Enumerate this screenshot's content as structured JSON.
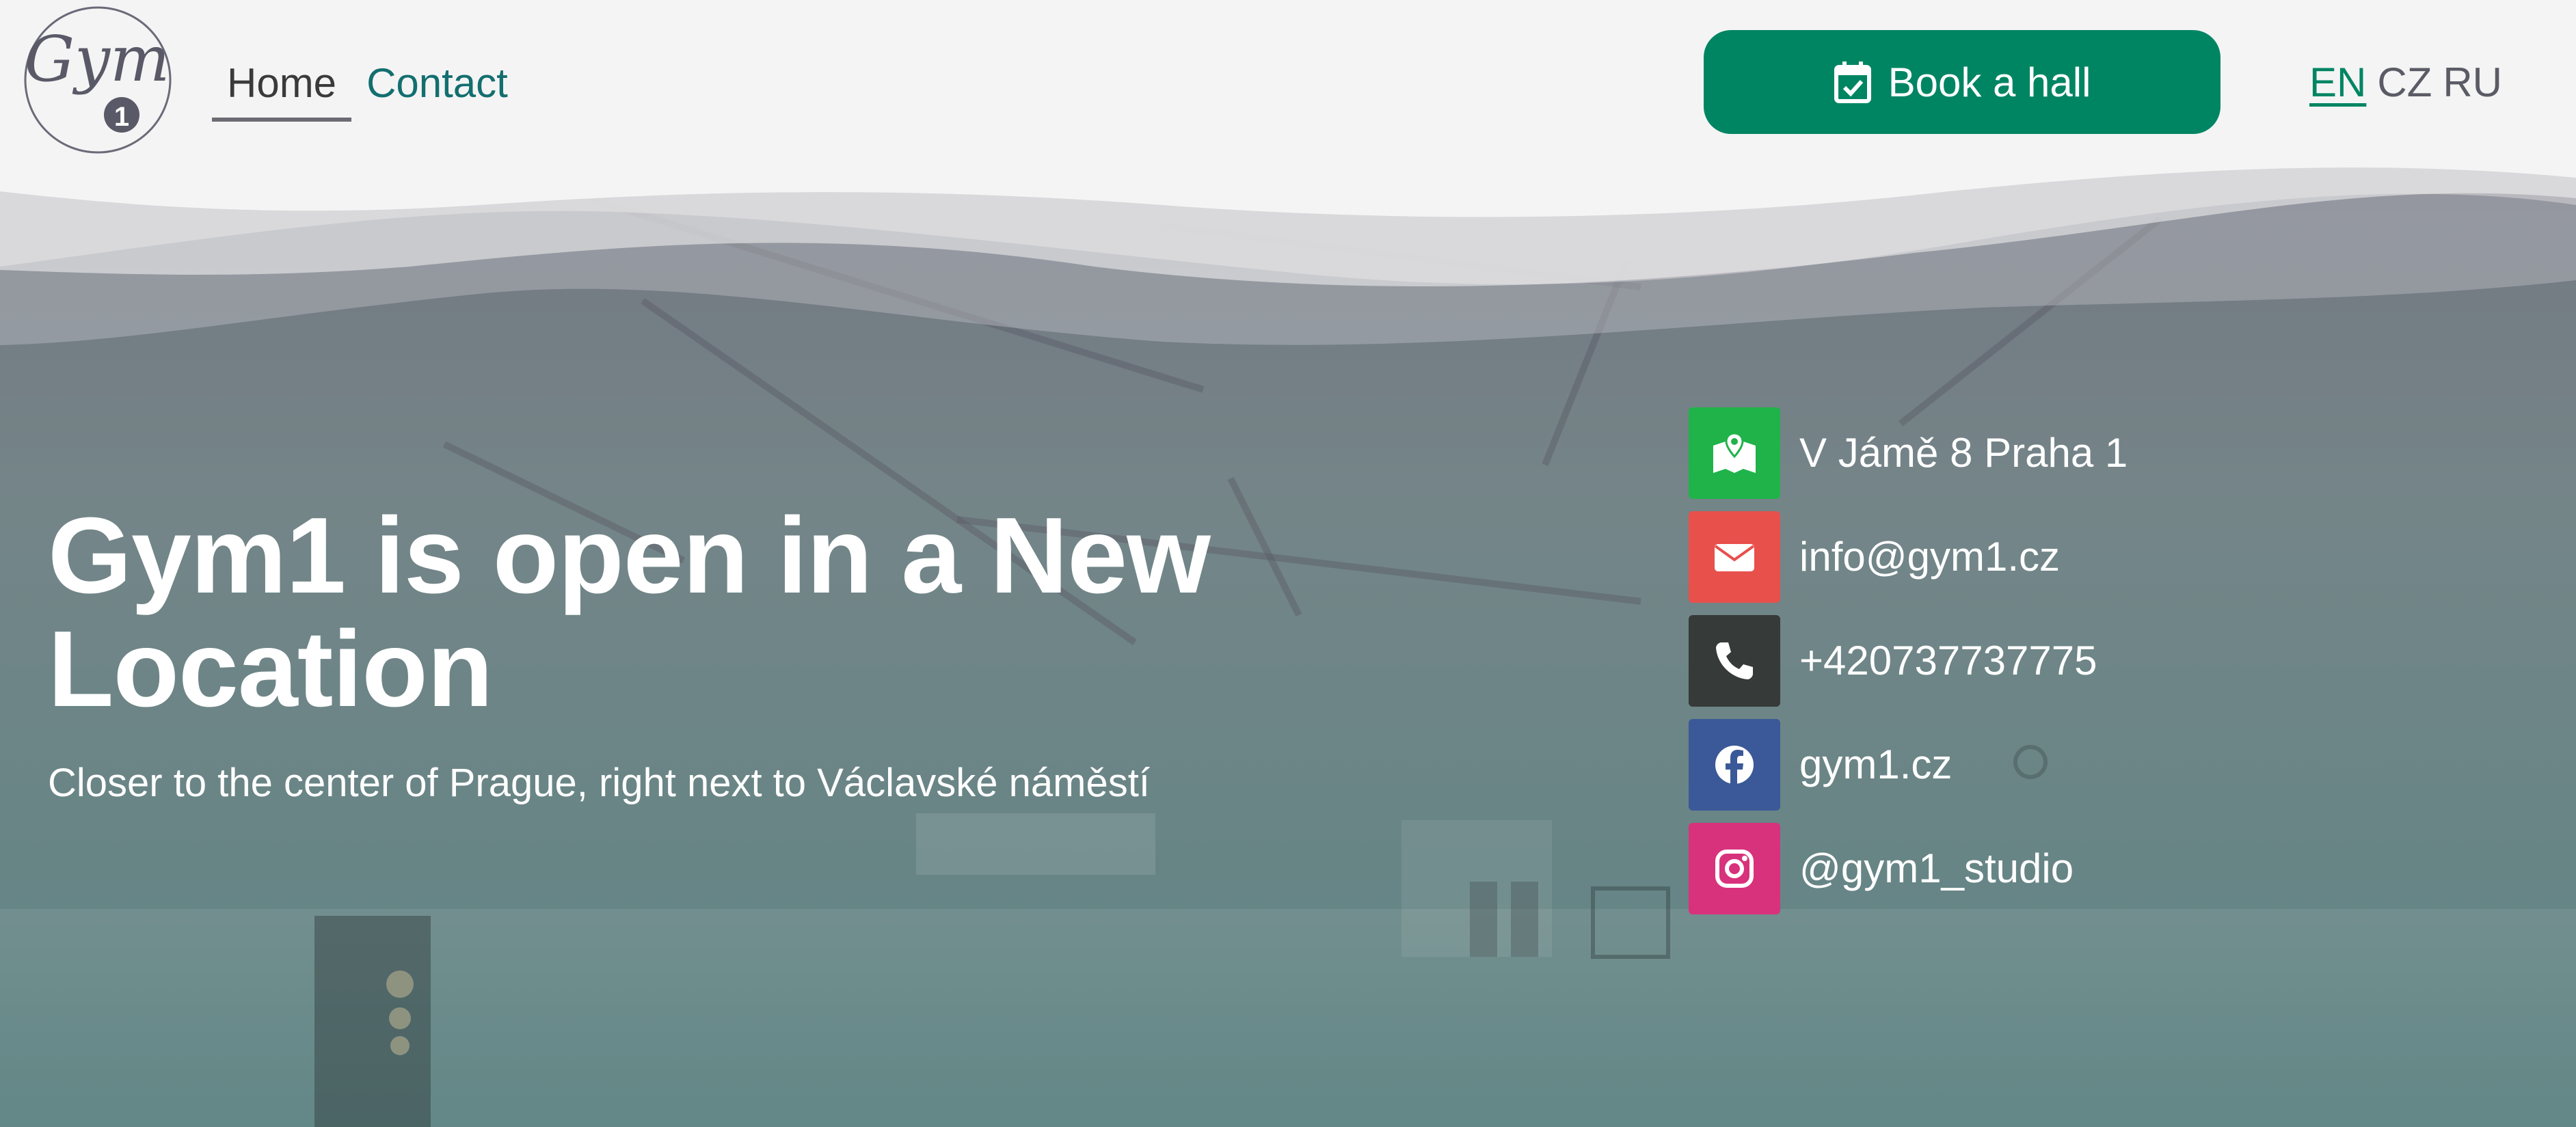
{
  "brand": {
    "logo_text": "Gym",
    "logo_number": "1"
  },
  "nav": {
    "items": [
      {
        "label": "Home",
        "active": true
      },
      {
        "label": "Contact",
        "active": false
      }
    ]
  },
  "header": {
    "book_label": "Book a hall",
    "languages": [
      {
        "label": "EN",
        "active": true
      },
      {
        "label": "CZ",
        "active": false
      },
      {
        "label": "RU",
        "active": false
      }
    ]
  },
  "hero": {
    "title": "Gym1 is open in a New Location",
    "subtitle": "Closer to the center of Prague, right next to Václavské náměstí"
  },
  "contacts": [
    {
      "icon": "map-icon",
      "text": "V Jámě 8 Praha 1",
      "color": "#1fb34a"
    },
    {
      "icon": "envelope-icon",
      "text": "info@gym1.cz",
      "color": "#e8504c"
    },
    {
      "icon": "phone-icon",
      "text": "+420737737775",
      "color": "#363a38"
    },
    {
      "icon": "facebook-icon",
      "text": "gym1.cz",
      "color": "#3b5998"
    },
    {
      "icon": "instagram-icon",
      "text": "@gym1_studio",
      "color": "#d8327c"
    }
  ],
  "colors": {
    "accent": "#008563",
    "link": "#136e6f",
    "header_bg": "#f4f4f4",
    "overlay_top": "#6d6a7c",
    "overlay_bottom": "#5f8584"
  }
}
